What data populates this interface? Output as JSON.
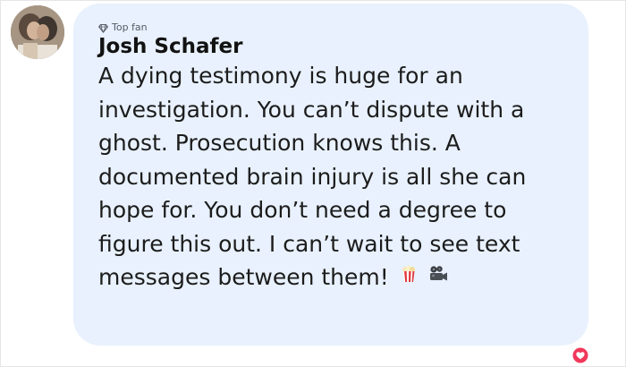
{
  "comment": {
    "badge_label": "Top fan",
    "badge_icon": "diamond-icon",
    "author": "Josh Schafer",
    "text": "A dying testimony is huge for an investigation. You can’t dispute with a ghost. Prosecution knows this. A documented brain injury is all she can hope for. You don’t need a degree to figure this out. I can’t wait to see text messages between them!",
    "emojis": [
      "popcorn-icon",
      "movie-camera-icon"
    ],
    "reaction_icon": "heart-icon"
  },
  "colors": {
    "bubble_background": "#e8f1fd",
    "reaction": "#f0385b"
  }
}
